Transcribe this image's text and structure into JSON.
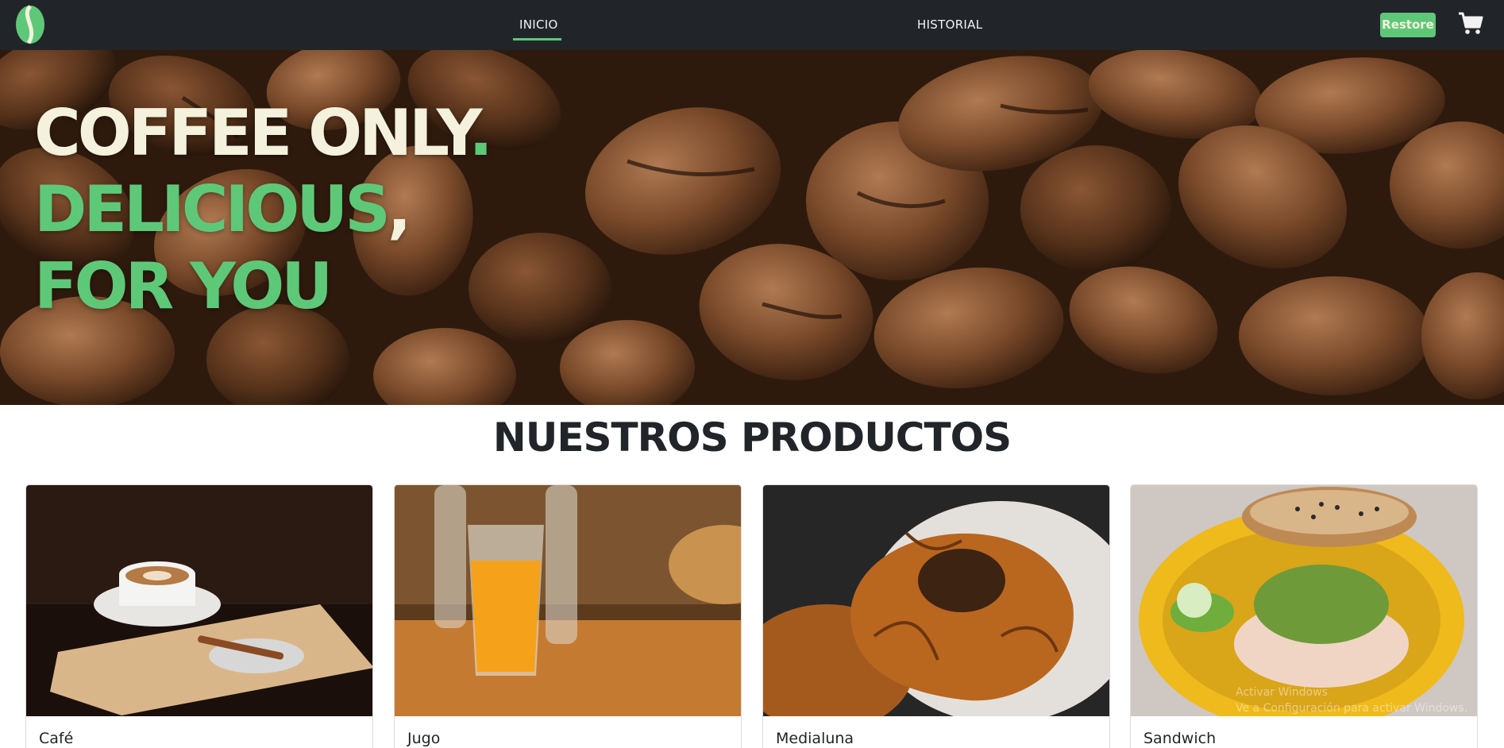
{
  "navbar": {
    "logo_icon": "coffee-bean-icon",
    "links": [
      {
        "label": "INICIO",
        "active": true
      },
      {
        "label": "HISTORIAL",
        "active": false
      }
    ],
    "restore_label": "Restore",
    "cart_icon": "shopping-cart-icon",
    "accent_color": "#5ec879",
    "background_color": "#212529"
  },
  "hero": {
    "line1": "COFFEE ONLY",
    "line1_punct": ".",
    "line2": "DELICIOUS",
    "line2_punct": ",",
    "line3": "FOR YOU",
    "cream_color": "#f4f1dc",
    "green_color": "#5ec879"
  },
  "products": {
    "title": "NUESTROS PRODUCTOS",
    "items": [
      {
        "name": "Café"
      },
      {
        "name": "Jugo"
      },
      {
        "name": "Medialuna"
      },
      {
        "name": "Sandwich"
      }
    ]
  },
  "os_overlay": {
    "line1": "Activar Windows",
    "line2": "Ve a Configuración para activar Windows."
  }
}
